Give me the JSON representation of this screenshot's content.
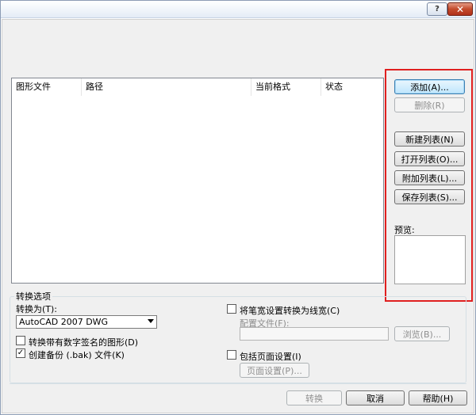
{
  "file_list": {
    "columns": [
      "图形文件",
      "路径",
      "当前格式",
      "状态"
    ]
  },
  "side_buttons": {
    "add": "添加(A)...",
    "remove": "删除(R)",
    "new_list": "新建列表(N)",
    "open_list": "打开列表(O)...",
    "append_list": "附加列表(L)...",
    "save_list": "保存列表(S)..."
  },
  "preview": {
    "label": "预览:"
  },
  "options": {
    "group_title": "转换选项",
    "convert_to_label": "转换为(T):",
    "convert_to_value": "AutoCAD 2007 DWG",
    "digital_signature": {
      "label": "转换带有数字签名的图形(D)",
      "checked": false
    },
    "backup": {
      "label": "创建备份 (.bak) 文件(K)",
      "checked": true,
      "check_mark": "✓"
    },
    "pen_width": {
      "label": "将笔宽设置转换为线宽(C)",
      "checked": false
    },
    "config_file_label": "配置文件(F):",
    "config_file_value": "",
    "browse": "浏览(B)...",
    "page_setup_include": {
      "label": "包括页面设置(I)",
      "checked": false
    },
    "page_setup_button": "页面设置(P)..."
  },
  "footer_buttons": {
    "convert": "转换",
    "cancel": "取消",
    "help": "帮助(H)"
  },
  "title_bar": {
    "help_glyph": "?",
    "close_glyph": "✕"
  },
  "colors": {
    "highlight": "#e02020",
    "dialog_bg": "#f0f0f0"
  }
}
